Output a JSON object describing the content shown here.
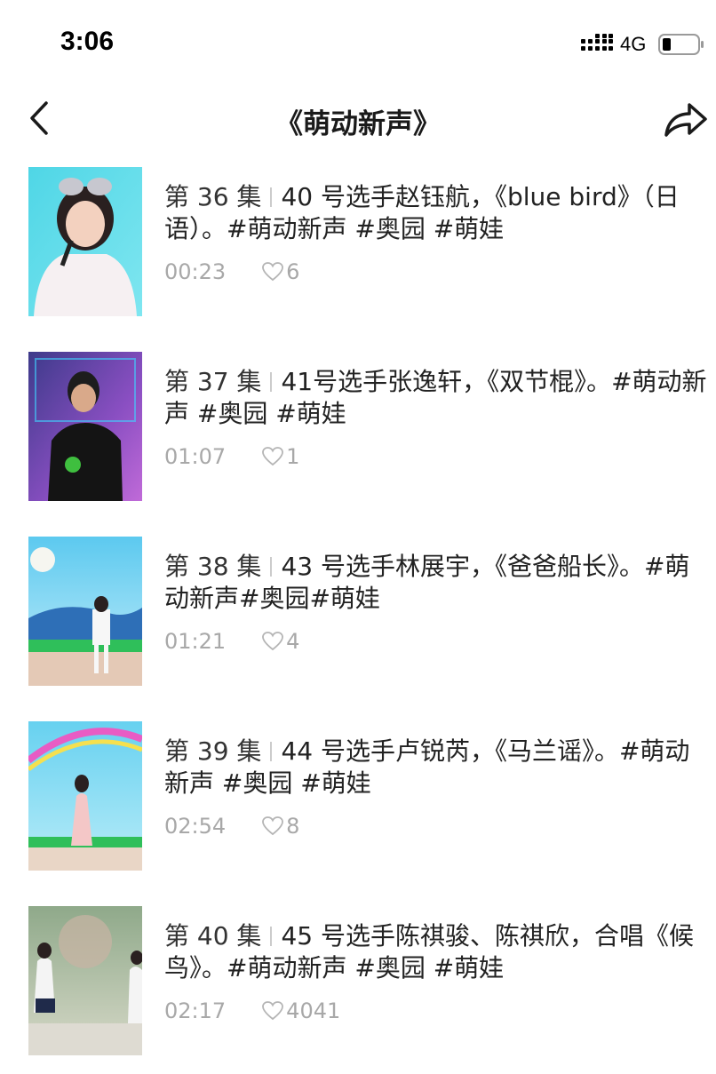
{
  "status_bar": {
    "time": "3:06",
    "network": "4G"
  },
  "header": {
    "title": "《萌动新声》"
  },
  "items": [
    {
      "episode": "第 36 集",
      "text": "40 号选手赵钰航，《blue bird》（日语）。#萌动新声 #奥园 #萌娃",
      "duration": "00:23",
      "likes": "6"
    },
    {
      "episode": "第 37 集",
      "text": "41号选手张逸轩，《双节棍》。#萌动新声 #奥园 #萌娃",
      "duration": "01:07",
      "likes": "1"
    },
    {
      "episode": "第 38 集",
      "text": "43 号选手林展宇，《爸爸船长》。#萌动新声#奥园#萌娃",
      "duration": "01:21",
      "likes": "4"
    },
    {
      "episode": "第 39 集",
      "text": "44 号选手卢锐芮，《马兰谣》。#萌动新声 #奥园 #萌娃",
      "duration": "02:54",
      "likes": "8"
    },
    {
      "episode": "第 40 集",
      "text": "45 号选手陈祺骏、陈祺欣，合唱《候鸟》。#萌动新声 #奥园 #萌娃",
      "duration": "02:17",
      "likes": "4041"
    }
  ]
}
